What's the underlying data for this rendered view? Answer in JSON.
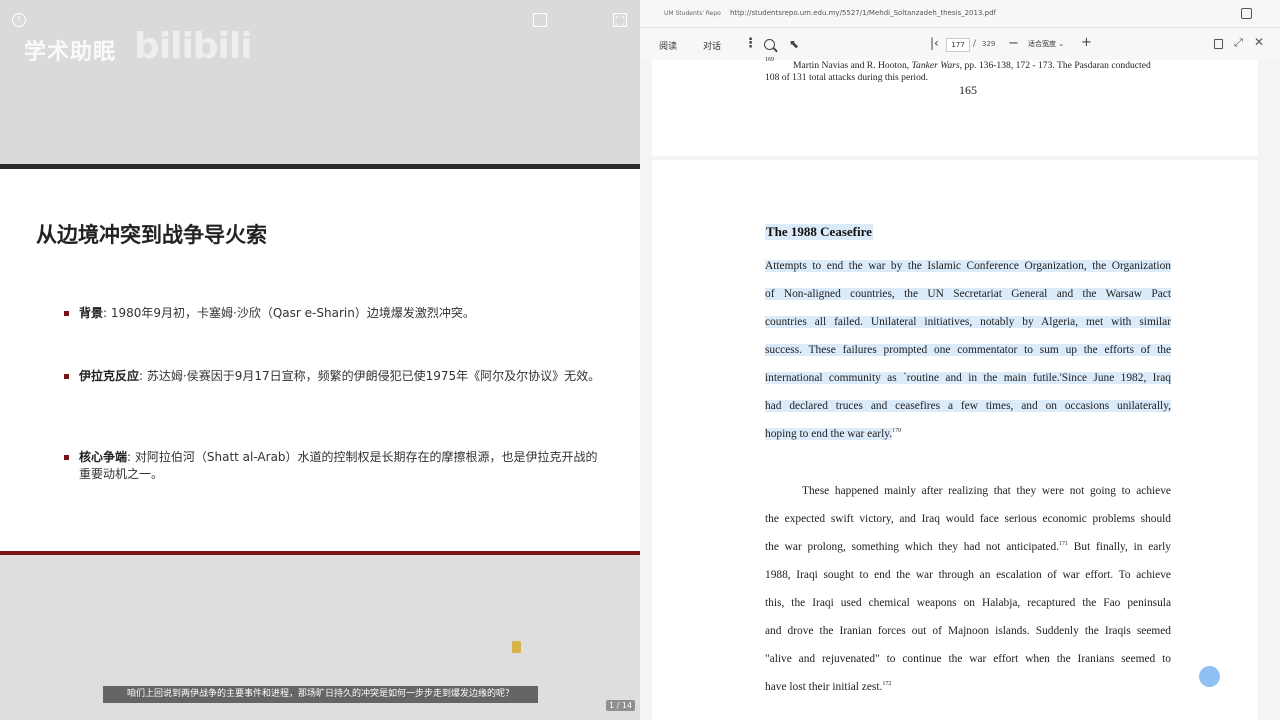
{
  "video": {
    "watermark_cn": "学术助眠",
    "watermark_logo": "bilibili",
    "subtitle": "咱们上回说到两伊战争的主要事件和进程，那场旷日持久的冲突是如何一步步走到爆发边缘的呢？",
    "slide_counter": "1 / 14"
  },
  "slide": {
    "title": "从边境冲突到战争导火索",
    "bullets": [
      {
        "label": "背景",
        "text": ": 1980年9月初，卡塞姆·沙欣（Qasr e-Sharin）边境爆发激烈冲突。"
      },
      {
        "label": "伊拉克反应",
        "text": ": 苏达姆·侯赛因于9月17日宣称，频繁的伊朗侵犯已使1975年《阿尔及尔协议》无效。"
      },
      {
        "label": "核心争端",
        "text": ": 对阿拉伯河（Shatt al-Arab）水道的控制权是长期存在的摩擦根源，也是伊拉克开战的重要动机之一。"
      }
    ],
    "colors": {
      "accent": "#7a1414",
      "topbar": "#2b2b2b"
    }
  },
  "pdf": {
    "site": "UM Students' Repo",
    "url": "http://studentsrepo.um.edu.my/5527/1/Mehdi_Soltanzadeh_thesis_2013.pdf",
    "toolbar": {
      "read_label": "阅读",
      "chat_label": "对话",
      "current_page": "177",
      "total_pages": "329",
      "zoom_label": "适合宽度"
    },
    "footnote": {
      "number": "169",
      "line1_pre": "Martin Navias and R. Hooton, ",
      "line1_italic": "Tanker Wars",
      "line1_post": ", pp. 136-138, 172 - 173. The Pasdaran conducted",
      "line2": "108 of 131 total attacks during this period."
    },
    "page_number": "165",
    "heading": "The 1988 Ceasefire",
    "paragraph1": [
      "Attempts to end the war by the Islamic Conference Organization, the Organization",
      "of Non-aligned countries, the UN Secretariat General and the Warsaw Pact",
      "countries all failed. Unilateral initiatives, notably by Algeria, met with similar",
      "success. These failures prompted one commentator to sum up the efforts of the",
      "international community as `routine and in the main futile.'Since June 1982, Iraq",
      "had declared truces and ceasefires a few times, and on occasions unilaterally,",
      "hoping to end the war early."
    ],
    "paragraph1_note": "170",
    "paragraph2": [
      "These happened mainly after realizing that they were not going to achieve",
      "the expected swift victory, and Iraq would face serious economic problems should",
      "the war prolong, something which they had not anticipated.",
      "1988, Iraqi sought to end the war through an escalation of war effort. To achieve",
      "this, the Iraqi used chemical weapons on Halabja, recaptured the Fao peninsula",
      "and drove the Iranian forces out of Majnoon islands. Suddenly the Iraqis seemed",
      "\"alive and rejuvenated\" to continue the war effort when the Iranians seemed to",
      "have lost their initial zest."
    ],
    "paragraph2_note_a": "171",
    "paragraph2_line3_tail": " But finally, in early",
    "paragraph2_note_b": "172",
    "colors": {
      "highlight": "#dcebfa"
    }
  }
}
